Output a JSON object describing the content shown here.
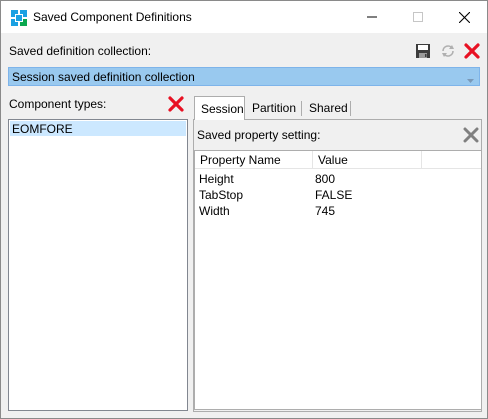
{
  "window": {
    "title": "Saved Component Definitions"
  },
  "collection": {
    "label": "Saved definition collection:",
    "selected": "Session saved definition collection"
  },
  "component_types": {
    "label": "Component types:",
    "items": [
      "EOMFORE"
    ]
  },
  "tabs": [
    {
      "label": "Session",
      "active": true
    },
    {
      "label": "Partition",
      "active": false
    },
    {
      "label": "Shared",
      "active": false
    }
  ],
  "property_setting": {
    "label": "Saved property setting:",
    "columns": [
      "Property Name",
      "Value"
    ],
    "rows": [
      {
        "name": "Height",
        "value": "800"
      },
      {
        "name": "TabStop",
        "value": "FALSE"
      },
      {
        "name": "Width",
        "value": "745"
      }
    ]
  },
  "colors": {
    "selection": "#99c9ef",
    "delete_red": "#e81123"
  }
}
